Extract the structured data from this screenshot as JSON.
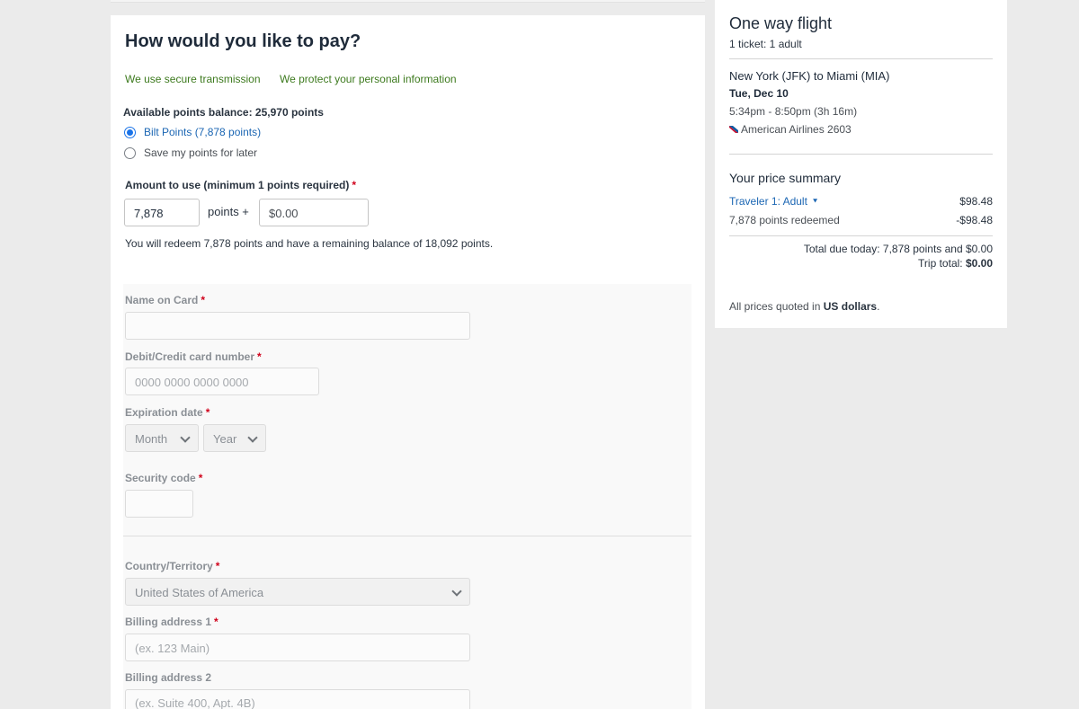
{
  "payment": {
    "title": "How would you like to pay?",
    "secure_1": "We use secure transmission",
    "secure_2": "We protect your personal information",
    "balance": "Available points balance: 25,970 points",
    "option_bilt": "Bilt Points (7,878 points)",
    "option_save": "Save my points for later",
    "amount_label": "Amount to use (minimum 1 points required)",
    "required_mark": "*",
    "points_value": "7,878",
    "points_plus": "points +",
    "cash_value": "$0.00",
    "redeem_message": "You will redeem 7,878 points and have a remaining balance of 18,092 points."
  },
  "card_form": {
    "name_label": "Name on Card",
    "number_label": "Debit/Credit card number",
    "number_placeholder": "0000 0000 0000 0000",
    "expiration_label": "Expiration date",
    "month_selected": "Month",
    "year_selected": "Year",
    "security_label": "Security code",
    "country_label": "Country/Territory",
    "country_selected": "United States of America",
    "address1_label": "Billing address 1",
    "address1_placeholder": "(ex. 123 Main)",
    "address2_label": "Billing address 2",
    "address2_placeholder": "(ex. Suite 400, Apt. 4B)"
  },
  "summary": {
    "title": "One way flight",
    "tickets": "1 ticket: 1 adult",
    "route": "New York (JFK) to Miami (MIA)",
    "date": "Tue, Dec 10",
    "times": "5:34pm - 8:50pm (3h 16m)",
    "airline": "American Airlines 2603",
    "price_title": "Your price summary",
    "traveler_label": "Traveler 1: Adult",
    "traveler_amount": "$98.48",
    "points_redeemed_label": "7,878 points redeemed",
    "points_redeemed_amount": "-$98.48",
    "total_due": "Total due today: 7,878 points and $0.00",
    "trip_total_label": "Trip total:",
    "trip_total_value": "$0.00",
    "prices_note_prefix": "All prices quoted in",
    "prices_note_currency": "US dollars",
    "prices_note_suffix": "."
  },
  "colors": {
    "accent_blue": "#1a73e8",
    "link_blue": "#1b66b3",
    "secure_green": "#3d7a1e",
    "required_red": "#d0021b"
  }
}
